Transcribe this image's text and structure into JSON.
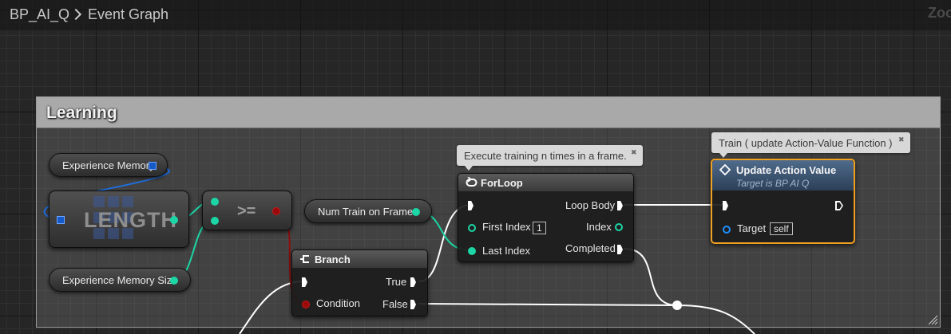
{
  "breadcrumb": {
    "blueprint": "BP_AI_Q",
    "graph": "Event Graph"
  },
  "zoom_label": "Zoo",
  "comment": {
    "title": "Learning"
  },
  "nodes": {
    "experience_memory": {
      "label": "Experience Memory"
    },
    "length": {
      "label": "LENGTH"
    },
    "compare": {
      "label": ">="
    },
    "experience_memory_size": {
      "label": "Experience Memory Size"
    },
    "num_train_on_frame": {
      "label": "Num Train on Frame"
    },
    "branch": {
      "title": "Branch",
      "true_label": "True",
      "false_label": "False",
      "condition_label": "Condition"
    },
    "forloop": {
      "title": "ForLoop",
      "first_index_label": "First Index",
      "first_index_value": "1",
      "last_index_label": "Last Index",
      "loop_body_label": "Loop Body",
      "index_label": "Index",
      "completed_label": "Completed",
      "bubble": "Execute training n times in a frame."
    },
    "update_action_value": {
      "title": "Update Action Value",
      "subtitle": "Target is BP AI Q",
      "target_label": "Target",
      "target_value": "self",
      "bubble": "Train ( update Action-Value Function )"
    }
  },
  "colors": {
    "teal_pin": "#1cd6a5",
    "bool_pin": "#9b0a0a",
    "object_pin": "#1e90ff",
    "array_pin": "#1659c9",
    "selected_outline": "#f0a020"
  }
}
